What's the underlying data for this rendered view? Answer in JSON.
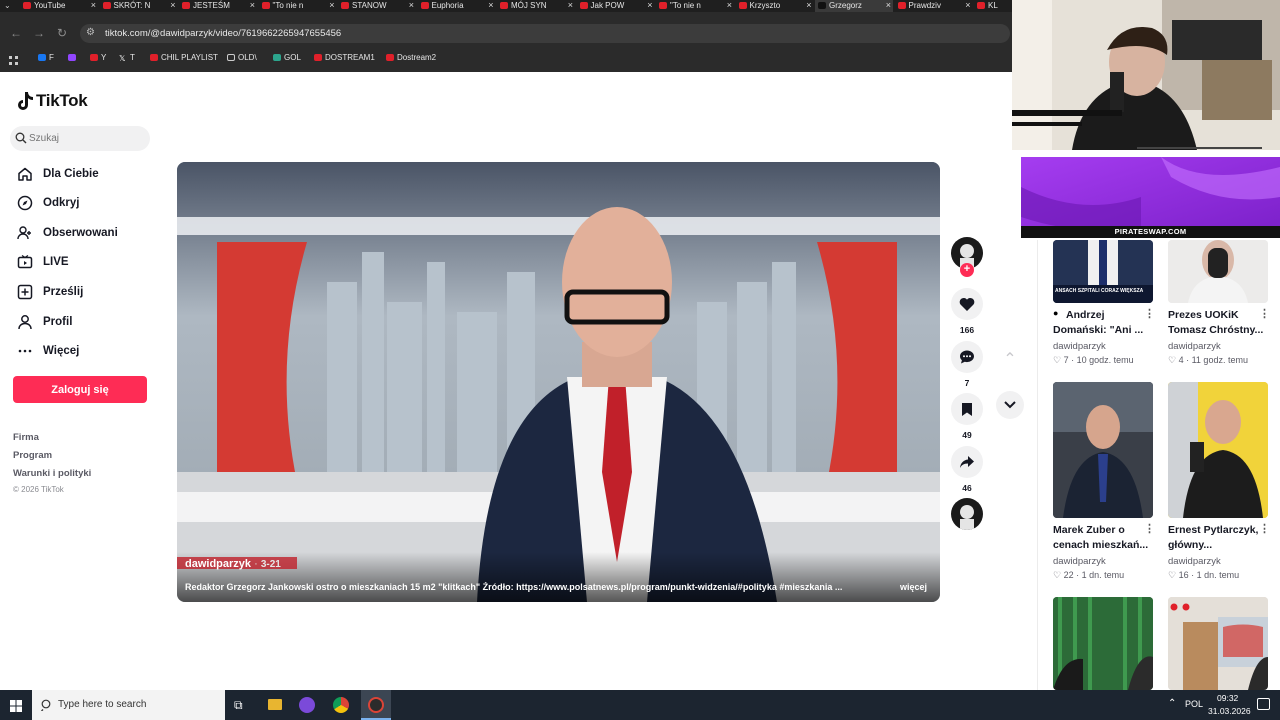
{
  "browser": {
    "tabs": [
      {
        "label": "YouTube",
        "active": false
      },
      {
        "label": "SKRÓT: N",
        "active": false
      },
      {
        "label": "JESTEŚM",
        "active": false
      },
      {
        "label": "\"To nie n",
        "active": false
      },
      {
        "label": "STANOW",
        "active": false
      },
      {
        "label": "Euphoria",
        "active": false
      },
      {
        "label": "MÓJ SYN",
        "active": false
      },
      {
        "label": "Jak POW",
        "active": false
      },
      {
        "label": "\"To nie n",
        "active": false
      },
      {
        "label": "Krzyszto",
        "active": false
      },
      {
        "label": "Grzegorz",
        "active": true
      },
      {
        "label": "Prawdziv",
        "active": false
      },
      {
        "label": "KL",
        "active": false
      }
    ],
    "url": "tiktok.com/@dawidparzyk/video/7619662265947655456",
    "bookmarks": [
      "F",
      "",
      "Y",
      "T",
      "CHIL PLAYLIST",
      "OLD\\",
      "GOL",
      "DOSTREAM1",
      "Dostream2"
    ]
  },
  "sidebar": {
    "logo": "TikTok",
    "search_placeholder": "Szukaj",
    "items": [
      {
        "label": "Dla Ciebie",
        "icon": "home-icon"
      },
      {
        "label": "Odkryj",
        "icon": "compass-icon"
      },
      {
        "label": "Obserwowani",
        "icon": "following-icon"
      },
      {
        "label": "LIVE",
        "icon": "live-icon"
      },
      {
        "label": "Prześlij",
        "icon": "upload-icon"
      },
      {
        "label": "Profil",
        "icon": "profile-icon"
      },
      {
        "label": "Więcej",
        "icon": "more-icon"
      }
    ],
    "login_label": "Zaloguj się",
    "footer": [
      "Firma",
      "Program",
      "Warunki i polityki",
      "© 2026 TikTok"
    ]
  },
  "video": {
    "author": "dawidparzyk",
    "date": "3-21",
    "caption": "Redaktor Grzegorz Jankowski ostro o mieszkaniach 15 m2 \"klitkach\" Źródło: https://www.polsatnews.pl/program/punkt-widzenia/#polityka #mieszkania ...",
    "more_label": "więcej"
  },
  "actions": {
    "likes": "166",
    "comments": "7",
    "saves": "49",
    "shares": "46"
  },
  "overlay": {
    "ad_text": "PIRATESWAP.COM"
  },
  "related": [
    {
      "title": "Andrzej Domański: \"Ani ...",
      "author": "dawidparzyk",
      "likes": "7",
      "time": "10 godz. temu",
      "thumb_text": "ANSACH SZPITALI CORAZ WIĘKSZA"
    },
    {
      "title": "Prezes UOKiK Tomasz Chróstny...",
      "author": "dawidparzyk",
      "likes": "4",
      "time": "11 godz. temu",
      "thumb_text": ""
    },
    {
      "title": "Marek Zuber o cenach mieszkań...",
      "author": "dawidparzyk",
      "likes": "22",
      "time": "1 dn. temu",
      "thumb_text": ""
    },
    {
      "title": "Ernest Pytlarczyk, główny...",
      "author": "dawidparzyk",
      "likes": "16",
      "time": "1 dn. temu",
      "thumb_text": ""
    }
  ],
  "taskbar": {
    "search_placeholder": "Type here to search",
    "lang": "POL",
    "time": "09:32",
    "date": "31.03.2026"
  },
  "colors": {
    "accent": "#fe2c55",
    "chrome_dark": "#2b2b2b",
    "taskbar": "#1c2530"
  }
}
